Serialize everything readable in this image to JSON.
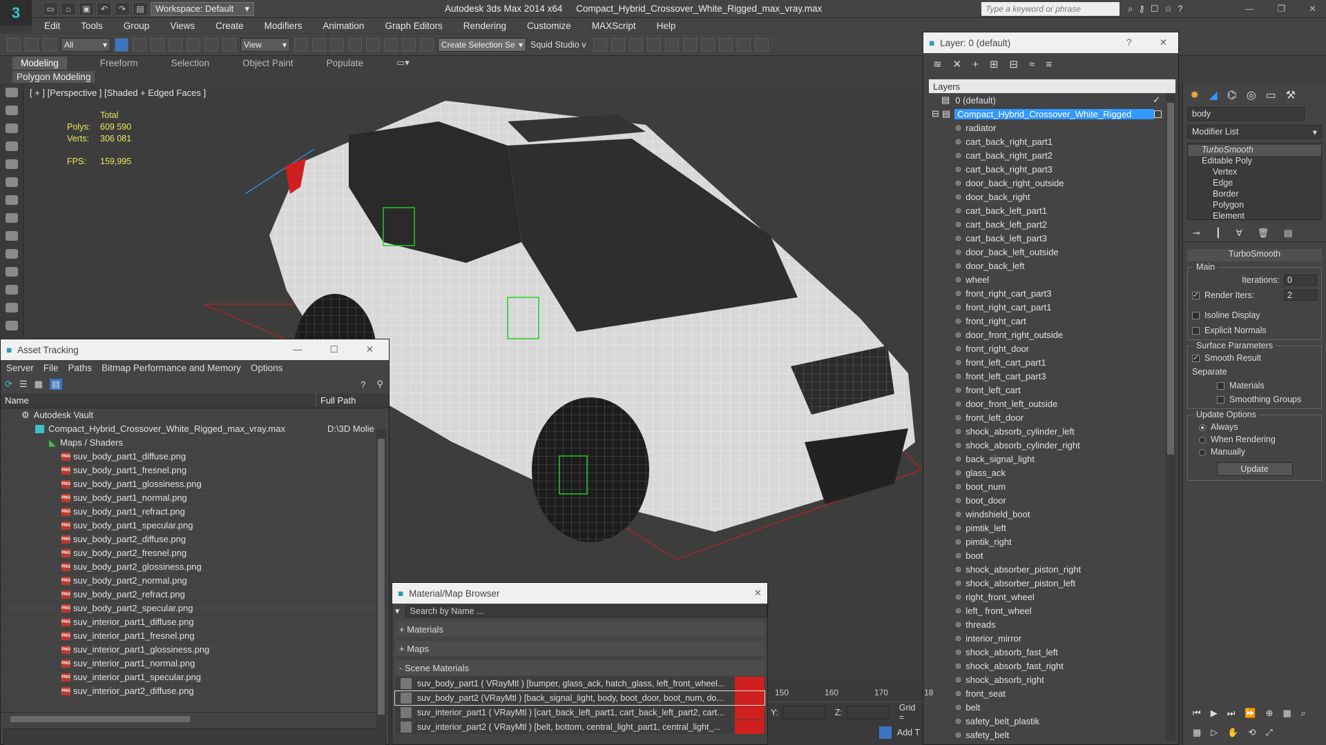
{
  "app": {
    "title": "Autodesk 3ds Max  2014 x64",
    "file": "Compact_Hybrid_Crossover_White_Rigged_max_vray.max",
    "workspace": "Workspace: Default",
    "search_placeholder": "Type a keyword or phrase"
  },
  "menu": [
    "Edit",
    "Tools",
    "Group",
    "Views",
    "Create",
    "Modifiers",
    "Animation",
    "Graph Editors",
    "Rendering",
    "Customize",
    "MAXScript",
    "Help"
  ],
  "toolbar": {
    "filter": "All",
    "view": "View",
    "selection_set": "Create Selection Se",
    "studio": "Squid Studio v"
  },
  "ribbon": {
    "tabs": [
      "Modeling",
      "Freeform",
      "Selection",
      "Object Paint",
      "Populate"
    ],
    "sub": "Polygon Modeling"
  },
  "viewport": {
    "label": "[ + ] [Perspective ] [Shaded + Edged Faces ]",
    "total": "Total",
    "polys_label": "Polys:",
    "polys": "609 590",
    "verts_label": "Verts:",
    "verts": "306 081",
    "fps_label": "FPS:",
    "fps": "159,995"
  },
  "asset_tracking": {
    "title": "Asset Tracking",
    "menu": [
      "Server",
      "File",
      "Paths",
      "Bitmap Performance and Memory",
      "Options"
    ],
    "col_name": "Name",
    "col_path": "Full Path",
    "vault": "Autodesk Vault",
    "file": "Compact_Hybrid_Crossover_White_Rigged_max_vray.max",
    "file_path": "D:\\3D Molie",
    "maps": "Maps / Shaders",
    "png_tag": "PNG",
    "items": [
      "suv_body_part1_diffuse.png",
      "suv_body_part1_fresnel.png",
      "suv_body_part1_glossiness.png",
      "suv_body_part1_normal.png",
      "suv_body_part1_refract.png",
      "suv_body_part1_specular.png",
      "suv_body_part2_diffuse.png",
      "suv_body_part2_fresnel.png",
      "suv_body_part2_glossiness.png",
      "suv_body_part2_normal.png",
      "suv_body_part2_refract.png",
      "suv_body_part2_specular.png",
      "suv_interior_part1_diffuse.png",
      "suv_interior_part1_fresnel.png",
      "suv_interior_part1_glossiness.png",
      "suv_interior_part1_normal.png",
      "suv_interior_part1_specular.png",
      "suv_interior_part2_diffuse.png"
    ]
  },
  "material_browser": {
    "title": "Material/Map Browser",
    "search_placeholder": "Search by Name ...",
    "sections": [
      "+ Materials",
      "+ Maps",
      "- Scene Materials"
    ],
    "materials": [
      "suv_body_part1  ( VRayMtl ) [bumper, glass_ack, hatch_glass, left_front_wheel...",
      "suv_body_part2 (VRayMtl ) [back_signal_light, body, boot_door, boot_num, do...",
      "suv_interior_part1  ( VRayMtl ) [cart_back_left_part1, cart_back_left_part2, cart...",
      "suv_interior_part2  ( VRayMtl ) [belt, bottom, central_light_part1, central_light_..."
    ]
  },
  "layers": {
    "title": "Layer: 0 (default)",
    "header": "Layers",
    "default_layer": "0 (default)",
    "root": "Compact_Hybrid_Crossover_White_Rigged",
    "items": [
      "radiator",
      "cart_back_right_part1",
      "cart_back_right_part2",
      "cart_back_right_part3",
      "door_back_right_outside",
      "door_back_right",
      "cart_back_left_part1",
      "cart_back_left_part2",
      "cart_back_left_part3",
      "door_back_left_outside",
      "door_back_left",
      "wheel",
      "front_right_cart_part3",
      "front_right_cart_part1",
      "front_right_cart",
      "door_front_right_outside",
      "front_right_door",
      "front_left_cart_part1",
      "front_left_cart_part3",
      "front_left_cart",
      "door_front_left_outside",
      "front_left_door",
      "shock_absorb_cylinder_left",
      "shock_absorb_cylinder_right",
      "back_signal_light",
      "glass_ack",
      "boot_num",
      "boot_door",
      "windshield_boot",
      "pimtik_left",
      "pimtik_right",
      "boot",
      "shock_absorber_piston_right",
      "shock_absorber_piston_left",
      "right_front_wheel",
      "left_ front_wheel",
      "threads",
      "interior_mirror",
      "shock_absorb_fast_left",
      "shock_absorb_fast_right",
      "shock_absorb_right",
      "front_seat",
      "belt",
      "safety_belt_plastik",
      "safety_belt"
    ]
  },
  "command_panel": {
    "object_name": "body",
    "modifier_list": "Modifier List",
    "stack": [
      "TurboSmooth",
      "Editable Poly",
      "Vertex",
      "Edge",
      "Border",
      "Polygon",
      "Element"
    ],
    "rollout": "TurboSmooth",
    "main": "Main",
    "iterations_label": "Iterations:",
    "iterations": "0",
    "render_iters_label": "Render Iters:",
    "render_iters": "2",
    "isoline": "Isoline Display",
    "explicit": "Explicit Normals",
    "surface": "Surface Parameters",
    "smooth": "Smooth Result",
    "separate": "Separate",
    "materials": "Materials",
    "smoothing_groups": "Smoothing Groups",
    "update_options": "Update Options",
    "always": "Always",
    "when_rendering": "When Rendering",
    "manually": "Manually",
    "update": "Update"
  },
  "timeline": {
    "ticks": [
      "150",
      "160",
      "170",
      "18"
    ],
    "y_label": "Y:",
    "z_label": "Z:",
    "grid_label": "Grid =",
    "add_label": "Add T"
  },
  "colors": {
    "accent": "#3399ff",
    "wire": "#ffffff",
    "selection_red": "#d01f1f",
    "stats_yellow": "#e9e95a"
  }
}
